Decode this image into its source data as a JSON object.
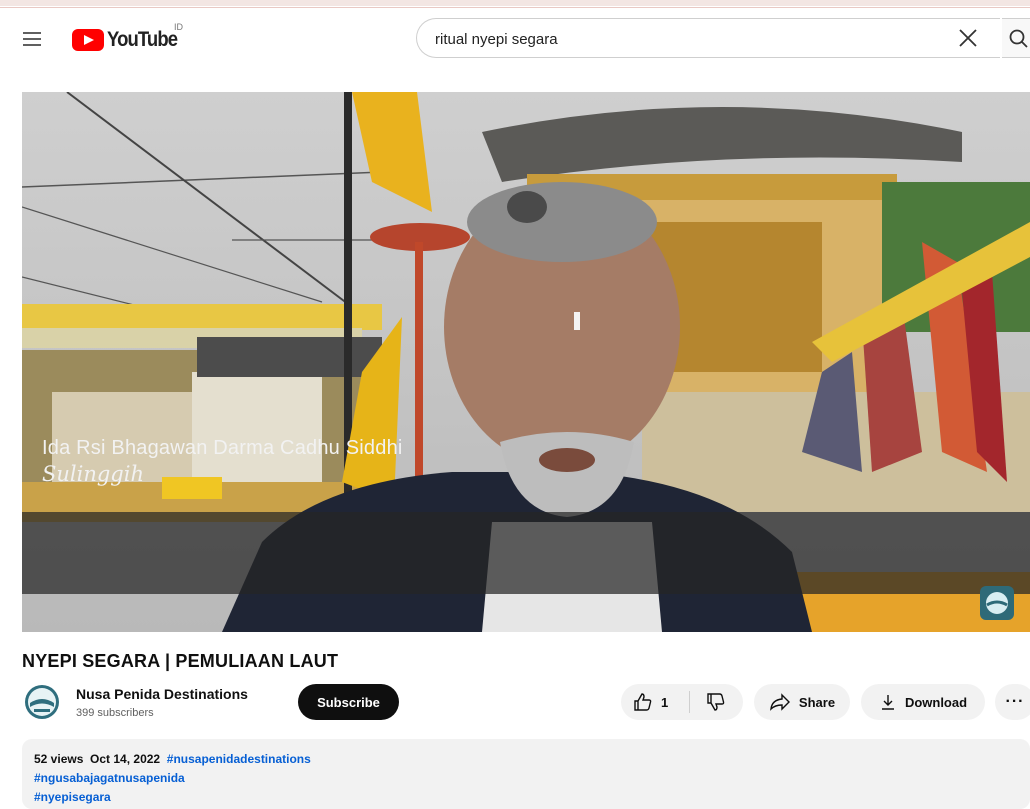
{
  "header": {
    "logo_text": "YouTube",
    "logo_sup": "ID",
    "search_query": "ritual nyepi segara"
  },
  "video": {
    "caption_name": "Ida Rsi Bhagawan Darma Cadhu Siddhi",
    "caption_role": "Sulinggih"
  },
  "info": {
    "title": "NYEPI SEGARA | PEMULIAAN LAUT",
    "channel_name": "Nusa Penida Destinations",
    "subscribers": "399 subscribers",
    "subscribe_label": "Subscribe",
    "like_count": "1",
    "share_label": "Share",
    "download_label": "Download",
    "more_label": "···"
  },
  "description": {
    "views": "52 views",
    "date": "Oct 14, 2022",
    "hashtags": [
      "#nusapenidadestinations",
      "#ngusabajagatnusapenida",
      "#nyepisegara"
    ]
  },
  "colors": {
    "brand_red": "#ff0000",
    "link_blue": "#065fd4",
    "subscribe_bg": "#0f0f0f",
    "pill_bg": "#f2f2f2"
  }
}
